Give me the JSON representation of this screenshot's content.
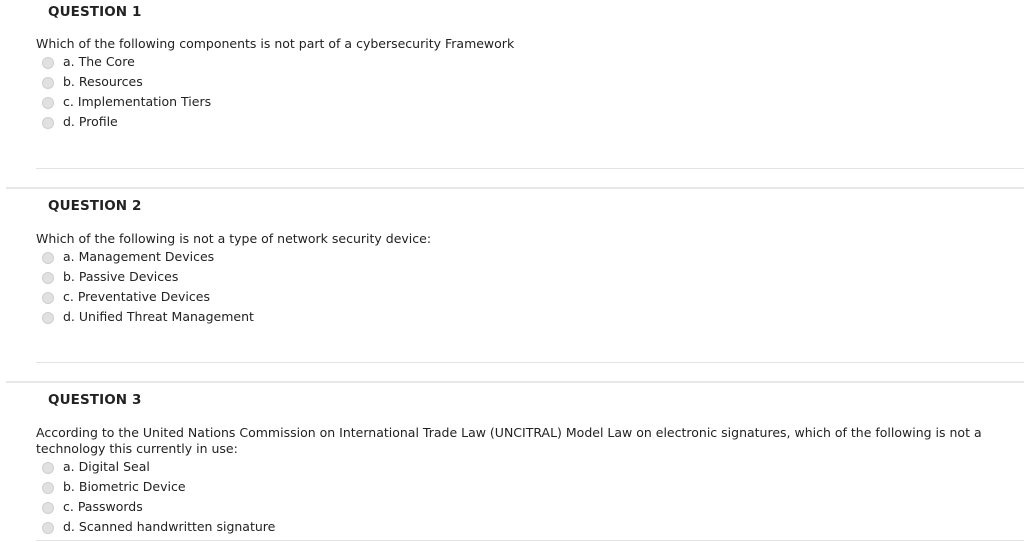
{
  "questions": [
    {
      "title": "QUESTION 1",
      "text": "Which of the following components is not part of a cybersecurity Framework",
      "options": [
        "a. The Core",
        "b. Resources",
        "c. Implementation Tiers",
        "d. Profile"
      ]
    },
    {
      "title": "QUESTION 2",
      "text": "Which of the following is not a type of network security device:",
      "options": [
        "a. Management Devices",
        "b. Passive Devices",
        "c. Preventative Devices",
        "d. Unified Threat Management"
      ]
    },
    {
      "title": "QUESTION 3",
      "text": "According to the United Nations Commission on International Trade Law (UNCITRAL) Model Law on electronic signatures, which of the following is not a technology this currently in use:",
      "options": [
        "a. Digital Seal",
        "b. Biometric Device",
        "c. Passwords",
        "d. Scanned handwritten signature"
      ]
    }
  ]
}
